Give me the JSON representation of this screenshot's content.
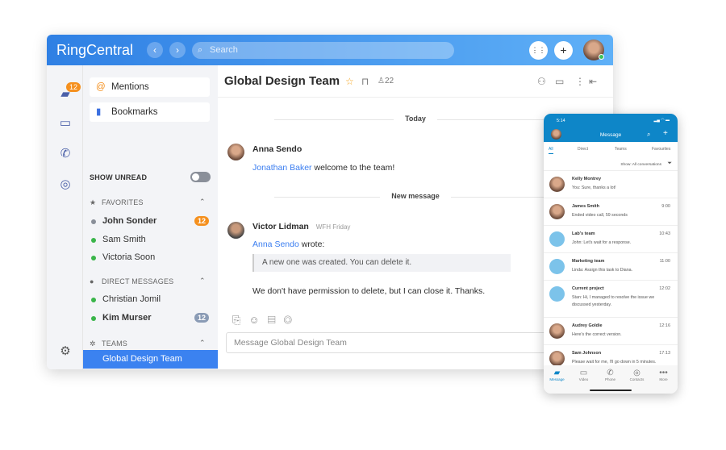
{
  "app": {
    "title": "RingCentral",
    "search_placeholder": "Search",
    "back": "‹",
    "forward": "›",
    "dialpad": "⋮⋮",
    "add": "+"
  },
  "rail": {
    "messages_badge": "12"
  },
  "sidebar": {
    "mentions": "Mentions",
    "bookmarks": "Bookmarks",
    "show_unread": "SHOW UNREAD",
    "show_unread_on": false,
    "favorites_label": "FAVORITES",
    "favorites": [
      {
        "name": "John Sonder",
        "badge": "12",
        "bold": true,
        "status": "offline"
      },
      {
        "name": "Sam Smith",
        "status": "online"
      },
      {
        "name": "Victoria Soon",
        "status": "online"
      }
    ],
    "dm_label": "DIRECT MESSAGES",
    "direct": [
      {
        "name": "Christian Jomil",
        "status": "online"
      },
      {
        "name": "Kim Murser",
        "badge": "12",
        "bold": true,
        "status": "online"
      }
    ],
    "teams_label": "TEAMS",
    "teams": [
      {
        "name": "Global Design Team",
        "selected": true
      }
    ]
  },
  "chat": {
    "title": "Global Design Team",
    "members": "22",
    "sep_today": "Today",
    "sep_new": "New message",
    "messages": [
      {
        "author": "Anna Sendo",
        "mention": "Jonathan Baker",
        "text": " welcome to the team!"
      },
      {
        "author": "Victor Lidman",
        "status": "WFH Friday",
        "mention": "Anna Sendo",
        "text": " wrote:",
        "quote": "A new one was created. You can delete it.",
        "text2": "We don't have permission to delete, but I can close it. Thanks."
      }
    ],
    "compose_placeholder": "Message Global Design Team"
  },
  "phone": {
    "time": "5:14",
    "title": "Message",
    "tabs": [
      "All",
      "Direct",
      "Teams",
      "Favourites"
    ],
    "filter": "Show: All conversations",
    "conversations": [
      {
        "name": "Kelly Montrey",
        "time": "",
        "msg": "You: Sure, thanks a lot!",
        "team": false
      },
      {
        "name": "James Smith",
        "time": "9:00",
        "msg": "Ended video call, 59 seconds",
        "team": false
      },
      {
        "name": "Lab's team",
        "time": "10:43",
        "msg": "John: Let's wait for a response.",
        "team": true
      },
      {
        "name": "Marketing team",
        "time": "11:00",
        "msg": "Linda: Assign this task to Diana.",
        "team": true
      },
      {
        "name": "Current project",
        "time": "12:02",
        "msg": "Stan: Hi, I managed to resolve the issue we discussed yesterday.",
        "team": true
      },
      {
        "name": "Audrey Goldie",
        "time": "12:16",
        "msg": "Here's the correct version.",
        "team": false
      },
      {
        "name": "Sam Johnson",
        "time": "17:13",
        "msg": "Please wait for me, I'll go down in 5 minutes.",
        "team": false
      }
    ],
    "nav": [
      "Message",
      "Video",
      "Phone",
      "Contacts",
      "More"
    ]
  },
  "colors": {
    "accent": "#3b82f0",
    "header": "#2f80e4",
    "badge": "#f5901e",
    "phone_header": "#0e86c8",
    "online": "#3ab54a"
  }
}
